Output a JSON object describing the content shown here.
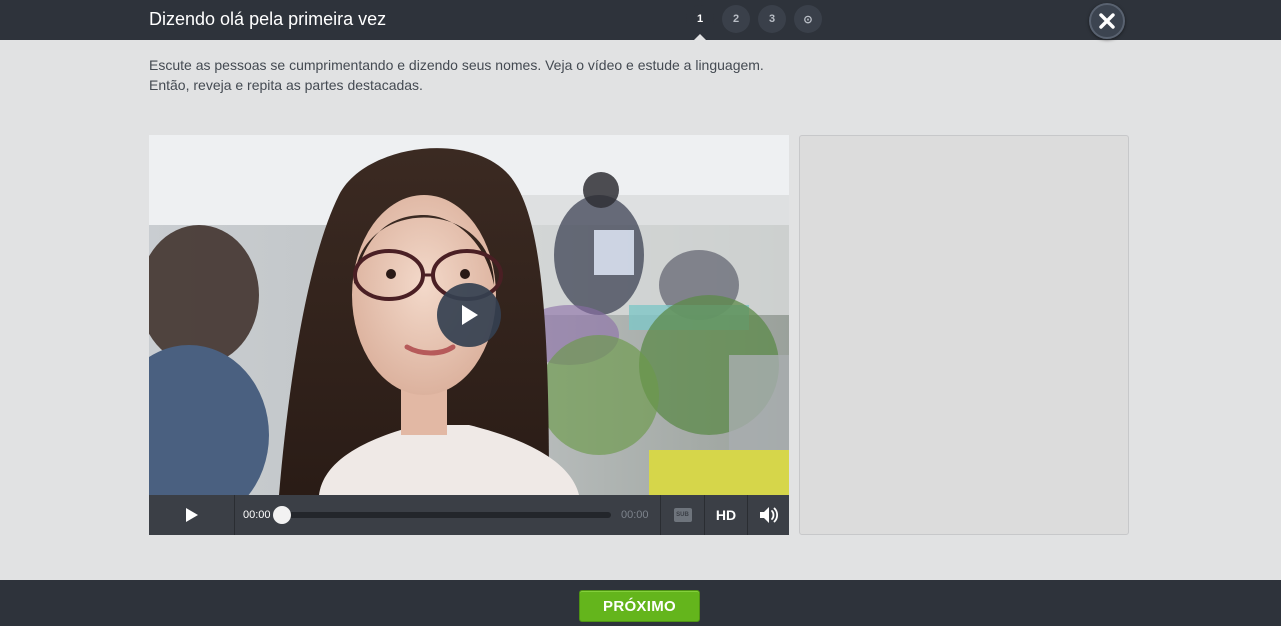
{
  "header": {
    "title": "Dizendo olá pela primeira vez",
    "steps": [
      "1",
      "2",
      "3",
      "⊙"
    ],
    "active_step": "1",
    "close_icon": "close-icon"
  },
  "instructions": {
    "line1": "Escute as pessoas se cumprimentando e dizendo seus nomes. Veja o vídeo e estude a linguagem.",
    "line2": "Então, reveja e repita as partes destacadas."
  },
  "player": {
    "current_time": "00:00",
    "duration": "00:00",
    "progress": 0,
    "subtitles_label": "SUB",
    "hd_label": "HD",
    "icons": {
      "big_play": "play-icon",
      "play": "play-icon",
      "subtitles": "subtitles-icon",
      "volume": "volume-icon"
    }
  },
  "footer": {
    "next_label": "PRÓXIMO"
  },
  "colors": {
    "topbar": "#2e333b",
    "page_bg": "#e1e2e3",
    "next_button": "#64b51c",
    "controls": "#3b3f46"
  }
}
